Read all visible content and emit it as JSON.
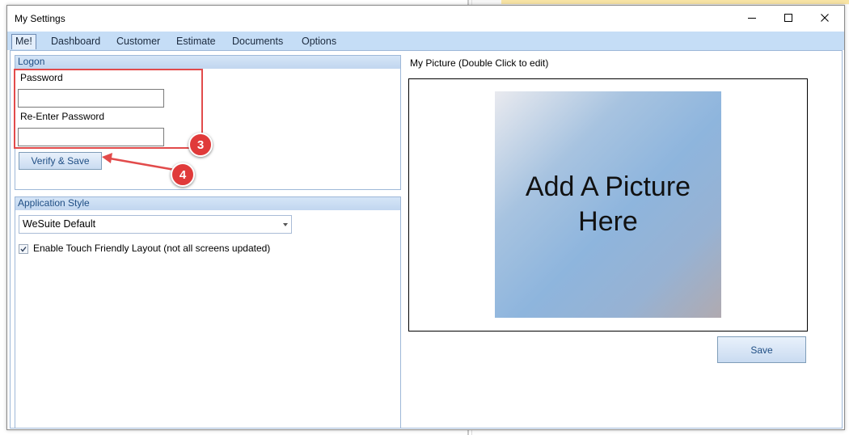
{
  "window": {
    "title": "My Settings"
  },
  "tabs": [
    "Me!",
    "Dashboard",
    "Customer",
    "Estimate",
    "Documents",
    "Options"
  ],
  "logon": {
    "header": "Logon",
    "password_label": "Password",
    "password_value": "",
    "reenter_label": "Re-Enter Password",
    "reenter_value": "",
    "verify_button": "Verify & Save"
  },
  "app_style": {
    "header": "Application Style",
    "selected": "WeSuite Default",
    "touch_checkbox_label": "Enable Touch Friendly Layout (not all screens updated)",
    "touch_checked": true
  },
  "picture": {
    "header": "My Picture (Double Click to edit)",
    "placeholder_line1": "Add A Picture",
    "placeholder_line2": "Here",
    "save_button": "Save"
  },
  "annotations": {
    "badge_1": "3",
    "badge_2": "4",
    "accent": "#e24b4b"
  }
}
